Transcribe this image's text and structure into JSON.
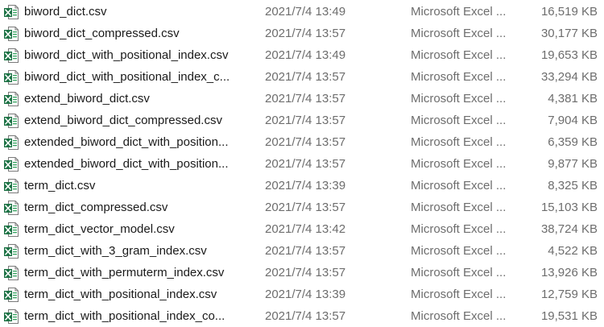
{
  "colors": {
    "excel_green": "#1d7245",
    "excel_green_light": "#33a15e",
    "name_text": "#1a1a1a",
    "meta_text": "#6d6d6d",
    "background": "#ffffff"
  },
  "file_icon": "excel-csv-file-icon",
  "files": [
    {
      "name": "biword_dict.csv",
      "modified": "2021/7/4 13:49",
      "type": "Microsoft Excel ...",
      "size": "16,519 KB"
    },
    {
      "name": "biword_dict_compressed.csv",
      "modified": "2021/7/4 13:57",
      "type": "Microsoft Excel ...",
      "size": "30,177 KB"
    },
    {
      "name": "biword_dict_with_positional_index.csv",
      "modified": "2021/7/4 13:49",
      "type": "Microsoft Excel ...",
      "size": "19,653 KB"
    },
    {
      "name": "biword_dict_with_positional_index_c...",
      "modified": "2021/7/4 13:57",
      "type": "Microsoft Excel ...",
      "size": "33,294 KB"
    },
    {
      "name": "extend_biword_dict.csv",
      "modified": "2021/7/4 13:57",
      "type": "Microsoft Excel ...",
      "size": "4,381 KB"
    },
    {
      "name": "extend_biword_dict_compressed.csv",
      "modified": "2021/7/4 13:57",
      "type": "Microsoft Excel ...",
      "size": "7,904 KB"
    },
    {
      "name": "extended_biword_dict_with_position...",
      "modified": "2021/7/4 13:57",
      "type": "Microsoft Excel ...",
      "size": "6,359 KB"
    },
    {
      "name": "extended_biword_dict_with_position...",
      "modified": "2021/7/4 13:57",
      "type": "Microsoft Excel ...",
      "size": "9,877 KB"
    },
    {
      "name": "term_dict.csv",
      "modified": "2021/7/4 13:39",
      "type": "Microsoft Excel ...",
      "size": "8,325 KB"
    },
    {
      "name": "term_dict_compressed.csv",
      "modified": "2021/7/4 13:57",
      "type": "Microsoft Excel ...",
      "size": "15,103 KB"
    },
    {
      "name": "term_dict_vector_model.csv",
      "modified": "2021/7/4 13:42",
      "type": "Microsoft Excel ...",
      "size": "38,724 KB"
    },
    {
      "name": "term_dict_with_3_gram_index.csv",
      "modified": "2021/7/4 13:57",
      "type": "Microsoft Excel ...",
      "size": "4,522 KB"
    },
    {
      "name": "term_dict_with_permuterm_index.csv",
      "modified": "2021/7/4 13:57",
      "type": "Microsoft Excel ...",
      "size": "13,926 KB"
    },
    {
      "name": "term_dict_with_positional_index.csv",
      "modified": "2021/7/4 13:39",
      "type": "Microsoft Excel ...",
      "size": "12,759 KB"
    },
    {
      "name": "term_dict_with_positional_index_co...",
      "modified": "2021/7/4 13:57",
      "type": "Microsoft Excel ...",
      "size": "19,531 KB"
    }
  ]
}
